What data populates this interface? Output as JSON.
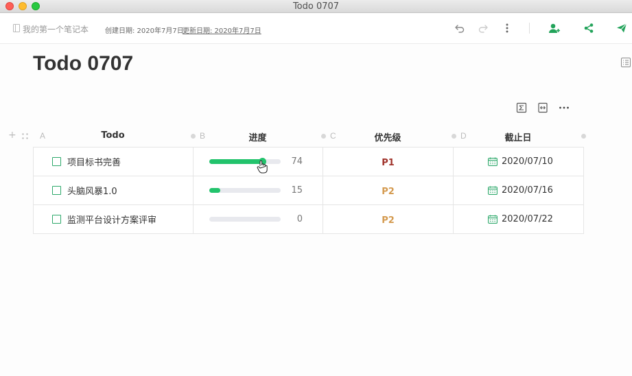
{
  "window": {
    "title": "Todo 0707"
  },
  "toolbar": {
    "notebook": "我的第一个笔记本",
    "created": "创建日期: 2020年7月7日",
    "updated": "更新日期: 2020年7月7日"
  },
  "doc": {
    "title": "Todo 0707"
  },
  "table": {
    "columns": [
      {
        "letter": "A",
        "header": "Todo"
      },
      {
        "letter": "B",
        "header": "进度"
      },
      {
        "letter": "C",
        "header": "优先级"
      },
      {
        "letter": "D",
        "header": "截止日"
      }
    ],
    "rows": [
      {
        "todo": "项目标书完善",
        "progress": 74,
        "progress_label": "74",
        "priority": "P1",
        "due": "2020/07/10"
      },
      {
        "todo": "头脑风暴1.0",
        "progress": 15,
        "progress_label": "15",
        "priority": "P2",
        "due": "2020/07/16"
      },
      {
        "todo": "监测平台设计方案评审",
        "progress": 0,
        "progress_label": "0",
        "priority": "P2",
        "due": "2020/07/22"
      }
    ]
  },
  "colors": {
    "accent": "#22c36c",
    "priority_p1": "#a0322a",
    "priority_p2": "#d49a4f",
    "track": "#e8e9ee"
  }
}
